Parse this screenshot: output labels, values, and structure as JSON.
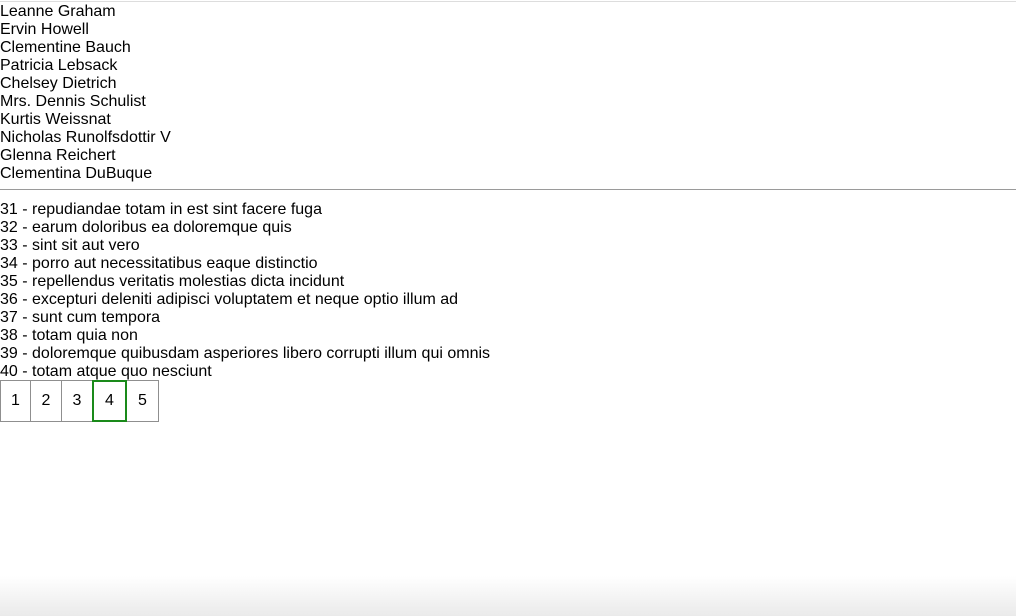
{
  "users": [
    {
      "name": "Leanne Graham"
    },
    {
      "name": "Ervin Howell"
    },
    {
      "name": "Clementine Bauch"
    },
    {
      "name": "Patricia Lebsack"
    },
    {
      "name": "Chelsey Dietrich"
    },
    {
      "name": "Mrs. Dennis Schulist"
    },
    {
      "name": "Kurtis Weissnat"
    },
    {
      "name": "Nicholas Runolfsdottir V"
    },
    {
      "name": "Glenna Reichert"
    },
    {
      "name": "Clementina DuBuque"
    }
  ],
  "posts": [
    {
      "text": "31 - repudiandae totam in est sint facere fuga"
    },
    {
      "text": "32 - earum doloribus ea doloremque quis"
    },
    {
      "text": "33 - sint sit aut vero"
    },
    {
      "text": "34 - porro aut necessitatibus eaque distinctio"
    },
    {
      "text": "35 - repellendus veritatis molestias dicta incidunt"
    },
    {
      "text": "36 - excepturi deleniti adipisci voluptatem et neque optio illum ad"
    },
    {
      "text": "37 - sunt cum tempora"
    },
    {
      "text": "38 - totam quia non"
    },
    {
      "text": "39 - doloremque quibusdam asperiores libero corrupti illum qui omnis"
    },
    {
      "text": "40 - totam atque quo nesciunt"
    }
  ],
  "pagination": {
    "pages": [
      "1",
      "2",
      "3",
      "4",
      "5"
    ],
    "current": "4",
    "active_color": "#1a8a1a"
  }
}
